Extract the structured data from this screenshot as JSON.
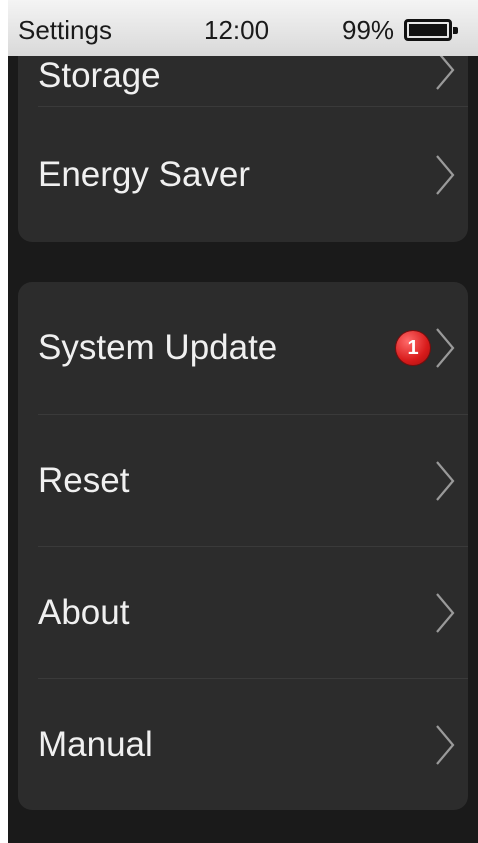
{
  "status_bar": {
    "app_name": "Settings",
    "time": "12:00",
    "battery_percent": "99%",
    "battery_level": 0.99
  },
  "group1": {
    "items": [
      {
        "label": "Storage"
      },
      {
        "label": "Energy Saver"
      }
    ]
  },
  "group2": {
    "items": [
      {
        "label": "System Update",
        "badge": "1"
      },
      {
        "label": "Reset"
      },
      {
        "label": "About"
      },
      {
        "label": "Manual"
      }
    ]
  },
  "icons": {
    "chevron": "chevron-right-icon",
    "battery": "battery-icon"
  },
  "colors": {
    "background": "#1a1a1a",
    "card": "#2c2c2c",
    "text": "#f0f0f0",
    "badge": "#d81b1b",
    "status_bar": "#e6e6e6"
  }
}
